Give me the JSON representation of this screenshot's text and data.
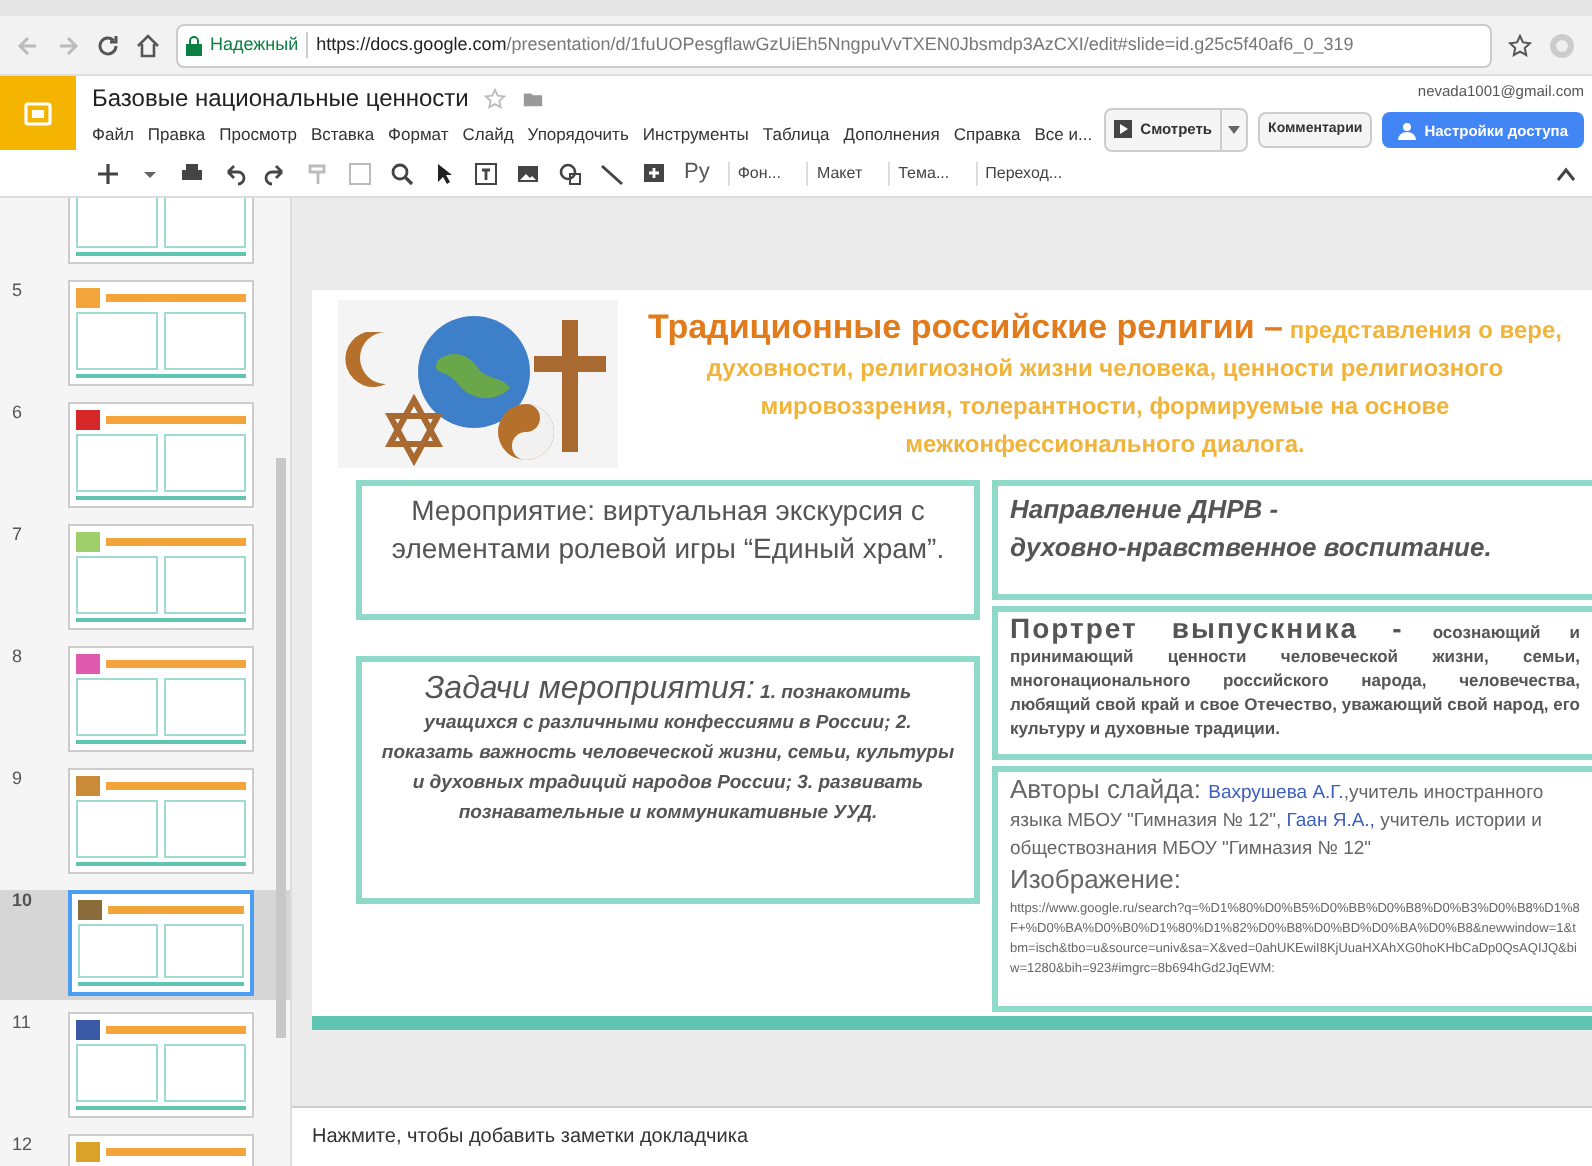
{
  "browser": {
    "secure_label": "Надежный",
    "url_host": "https://docs.google.com",
    "url_path": "/presentation/d/1fuUOPesgflawGzUiEh5NngpuVvTXEN0Jbsmdp3AzCXI/edit#slide=id.g25c5f40af6_0_319"
  },
  "document": {
    "title": "Базовые национальные ценности",
    "account": "nevada1001@gmail.com",
    "menus": [
      "Файл",
      "Правка",
      "Просмотр",
      "Вставка",
      "Формат",
      "Слайд",
      "Упорядочить",
      "Инструменты",
      "Таблица",
      "Дополнения",
      "Справка",
      "Все и..."
    ],
    "present_button": "Смотреть",
    "comments_button": "Комментарии",
    "share_button": "Настройки доступа"
  },
  "toolbar": {
    "font_button": "Ру",
    "items": [
      "Фон...",
      "Макет",
      "Тема...",
      "Переход..."
    ]
  },
  "filmstrip": [
    {
      "selected": false
    },
    {
      "number": "5",
      "selected": false
    },
    {
      "number": "6",
      "selected": false
    },
    {
      "number": "7",
      "selected": false
    },
    {
      "number": "8",
      "selected": false
    },
    {
      "number": "9",
      "selected": false
    },
    {
      "number": "10",
      "selected": true
    },
    {
      "number": "11",
      "selected": false
    },
    {
      "number": "12",
      "selected": false
    }
  ],
  "slide": {
    "title_heading": "Традиционные российские религии –",
    "title_text": "представления о вере, духовности, религиозной жизни человека, ценности религиозного мировоззрения, толерантности, формируемые на основе межконфессионального диалога.",
    "event": "Мероприятие: виртуальная экскурсия с элементами ролевой игры  “Единый храм”.",
    "goals_heading": "Задачи мероприятия:",
    "goals_text": "1. познакомить учащихся с различными конфессиями в России; 2. показать важность человеческой жизни, семьи, культуры и духовных традиций народов России; 3. развивать познавательные и коммуникативные УУД.",
    "direction": [
      "Направление ДНРВ -",
      "духовно-нравственное воспитание."
    ],
    "portrait_heading": "Портрет выпускника -",
    "portrait_text": "осознающий и принимающий ценности человеческой жизни, семьи, многонационального российского народа, человечества, любящий свой край и свое Отечество, уважающий свой народ, его культуру и духовные традиции.",
    "authors_label": "Авторы слайда:",
    "authors": [
      {
        "kind": "link",
        "text": "Вахрушева А.Г."
      },
      {
        "kind": "text",
        "text": ",учитель иностранного языка МБОУ \"Гимназия № 12\",  "
      },
      {
        "kind": "link",
        "text": "Гаан Я.А.,"
      },
      {
        "kind": "text",
        "text": " учитель истории и обществознания МБОУ \"Гимназия № 12\""
      }
    ],
    "image_label": "Изображение:",
    "image_url": "https://www.google.ru/search?q=%D1%80%D0%B5%D0%BB%D0%B8%D0%B3%D0%B8%D1%8F+%D0%BA%D0%B0%D1%80%D1%82%D0%B8%D0%BD%D0%BA%D0%B8&newwindow=1&tbm=isch&tbo=u&source=univ&sa=X&ved=0ahUKEwiI8KjUuaHXAhXG0hoKHbCaDp0QsAQIJQ&biw=1280&bih=923#imgrc=8b694hGd2JqEWM:"
  },
  "notes": {
    "placeholder": "Нажмите, чтобы добавить заметки докладчика"
  }
}
